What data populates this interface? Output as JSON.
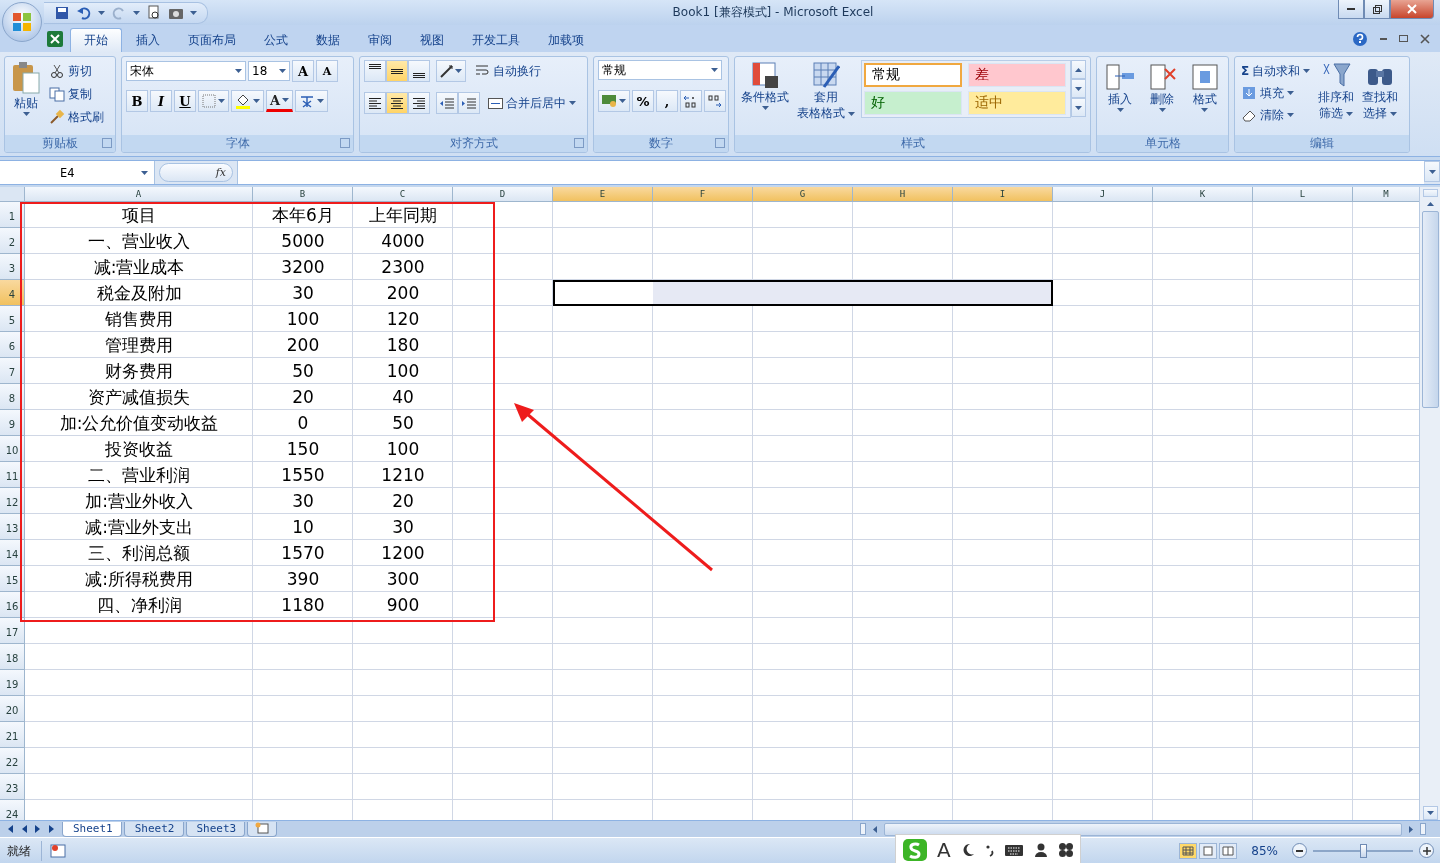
{
  "window": {
    "title": "Book1  [兼容模式] - Microsoft Excel"
  },
  "ribbon_tabs": [
    {
      "label": "开始",
      "selected": true
    },
    {
      "label": "插入",
      "selected": false
    },
    {
      "label": "页面布局",
      "selected": false
    },
    {
      "label": "公式",
      "selected": false
    },
    {
      "label": "数据",
      "selected": false
    },
    {
      "label": "审阅",
      "selected": false
    },
    {
      "label": "视图",
      "selected": false
    },
    {
      "label": "开发工具",
      "selected": false
    },
    {
      "label": "加载项",
      "selected": false
    }
  ],
  "ribbon": {
    "clipboard": {
      "label": "剪贴板",
      "paste": "粘贴",
      "cut": "剪切",
      "copy": "复制",
      "format_painter": "格式刷"
    },
    "font": {
      "label": "字体",
      "name": "宋体",
      "size": "18",
      "grow": "A",
      "shrink": "A",
      "bold": "B",
      "italic": "I",
      "underline": "U",
      "font_color": "A"
    },
    "alignment": {
      "label": "对齐方式",
      "wrap_text": "自动换行",
      "merge_center": "合并后居中",
      "valign": [
        {
          "kind": "top",
          "selected": false
        },
        {
          "kind": "middle",
          "selected": true
        },
        {
          "kind": "bottom",
          "selected": false
        }
      ],
      "halign": [
        {
          "kind": "left",
          "selected": false
        },
        {
          "kind": "center",
          "selected": true
        },
        {
          "kind": "right",
          "selected": false
        }
      ]
    },
    "number": {
      "label": "数字",
      "format": "常规",
      "percent": "%",
      "comma": ","
    },
    "styles": {
      "label": "样式",
      "conditional": "条件格式",
      "table_format": [
        "套用",
        "表格格式"
      ],
      "cell_styles": [
        {
          "label": "常规",
          "kind": "normal",
          "selected": true
        },
        {
          "label": "差",
          "kind": "bad",
          "selected": false
        },
        {
          "label": "好",
          "kind": "good",
          "selected": false
        },
        {
          "label": "适中",
          "kind": "neutral",
          "selected": false
        }
      ]
    },
    "cells": {
      "label": "单元格",
      "insert": "插入",
      "delete": "删除",
      "format": "格式"
    },
    "editing": {
      "label": "编辑",
      "autosum_symbol": "Σ",
      "autosum": "自动求和",
      "fill": "填充",
      "clear": "清除",
      "sort": [
        "排序和",
        "筛选"
      ],
      "find": [
        "查找和",
        "选择"
      ]
    }
  },
  "formula_bar": {
    "name_box": "E4",
    "fx": "fx"
  },
  "columns": [
    {
      "label": "A",
      "selected": false
    },
    {
      "label": "B",
      "selected": false
    },
    {
      "label": "C",
      "selected": false
    },
    {
      "label": "D",
      "selected": false
    },
    {
      "label": "E",
      "selected": true
    },
    {
      "label": "F",
      "selected": true
    },
    {
      "label": "G",
      "selected": true
    },
    {
      "label": "H",
      "selected": true
    },
    {
      "label": "I",
      "selected": true
    },
    {
      "label": "J",
      "selected": false
    },
    {
      "label": "K",
      "selected": false
    },
    {
      "label": "L",
      "selected": false
    },
    {
      "label": "M",
      "selected": false
    }
  ],
  "rows": [
    {
      "label": "1",
      "selected": false,
      "cells": [
        "项目",
        "本年6月",
        "上年同期"
      ]
    },
    {
      "label": "2",
      "selected": false,
      "cells": [
        "一、营业收入",
        "5000",
        "4000"
      ]
    },
    {
      "label": "3",
      "selected": false,
      "cells": [
        "减:营业成本",
        "3200",
        "2300"
      ]
    },
    {
      "label": "4",
      "selected": true,
      "cells": [
        "税金及附加",
        "30",
        "200"
      ]
    },
    {
      "label": "5",
      "selected": false,
      "cells": [
        "销售费用",
        "100",
        "120"
      ]
    },
    {
      "label": "6",
      "selected": false,
      "cells": [
        "管理费用",
        "200",
        "180"
      ]
    },
    {
      "label": "7",
      "selected": false,
      "cells": [
        "财务费用",
        "50",
        "100"
      ]
    },
    {
      "label": "8",
      "selected": false,
      "cells": [
        "资产减值损失",
        "20",
        "40"
      ]
    },
    {
      "label": "9",
      "selected": false,
      "cells": [
        "加:公允价值变动收益",
        "0",
        "50"
      ]
    },
    {
      "label": "10",
      "selected": false,
      "cells": [
        "投资收益",
        "150",
        "100"
      ]
    },
    {
      "label": "11",
      "selected": false,
      "cells": [
        "二、营业利润",
        "1550",
        "1210"
      ]
    },
    {
      "label": "12",
      "selected": false,
      "cells": [
        "加:营业外收入",
        "30",
        "20"
      ]
    },
    {
      "label": "13",
      "selected": false,
      "cells": [
        "减:营业外支出",
        "10",
        "30"
      ]
    },
    {
      "label": "14",
      "selected": false,
      "cells": [
        "三、利润总额",
        "1570",
        "1200"
      ]
    },
    {
      "label": "15",
      "selected": false,
      "cells": [
        "减:所得税费用",
        "390",
        "300"
      ]
    },
    {
      "label": "16",
      "selected": false,
      "cells": [
        "四、净利润",
        "1180",
        "900"
      ]
    },
    {
      "label": "17",
      "selected": false,
      "cells": []
    },
    {
      "label": "18",
      "selected": false,
      "cells": []
    },
    {
      "label": "19",
      "selected": false,
      "cells": []
    },
    {
      "label": "20",
      "selected": false,
      "cells": []
    },
    {
      "label": "21",
      "selected": false,
      "cells": []
    },
    {
      "label": "22",
      "selected": false,
      "cells": []
    },
    {
      "label": "23",
      "selected": false,
      "cells": []
    },
    {
      "label": "24",
      "selected": false,
      "cells": []
    }
  ],
  "sheet_tabs": [
    {
      "label": "Sheet1",
      "selected": true
    },
    {
      "label": "Sheet2",
      "selected": false
    },
    {
      "label": "Sheet3",
      "selected": false
    }
  ],
  "ime_toolbar": {
    "letter": "A"
  },
  "status_bar": {
    "status": "就绪",
    "zoom": "85%",
    "zoom_slider": {
      "level": 0.5
    },
    "views": [
      {
        "kind": "normal",
        "selected": true
      },
      {
        "kind": "layout",
        "selected": false
      },
      {
        "kind": "page_break",
        "selected": false
      }
    ]
  }
}
